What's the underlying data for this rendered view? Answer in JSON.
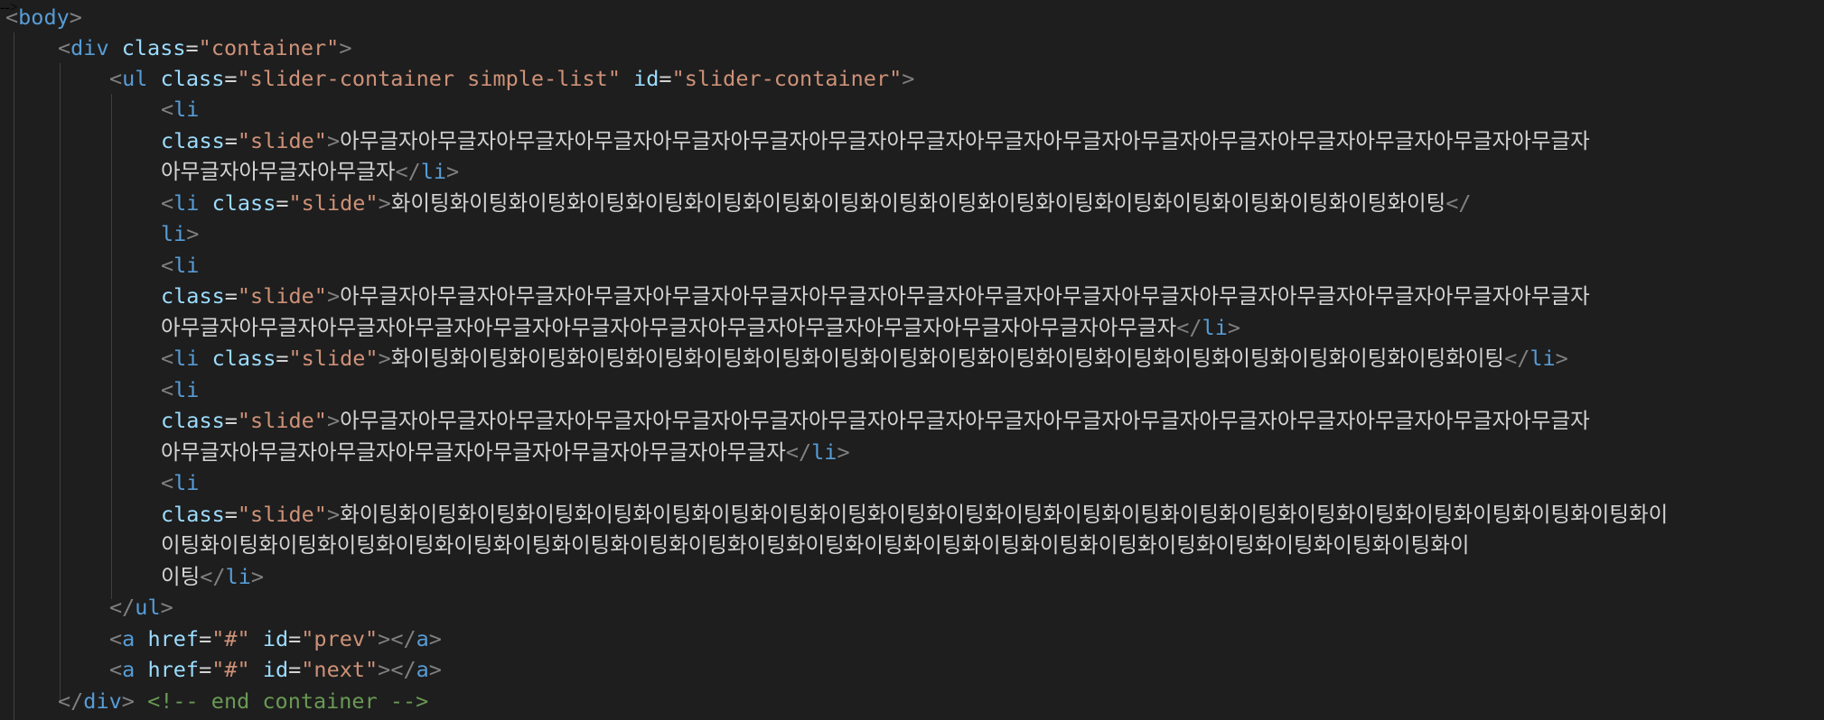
{
  "colors": {
    "background": "#1e1e1e",
    "tag": "#569cd6",
    "bracket": "#808080",
    "attribute": "#9cdcfe",
    "string": "#ce9178",
    "text": "#d4d4d4",
    "comment": "#6a9955",
    "indent_guide": "#404040"
  },
  "code": {
    "body_tag": "body",
    "div_tag": "div",
    "ul_tag": "ul",
    "li_tag": "li",
    "a_tag": "a",
    "class_attr": "class",
    "id_attr": "id",
    "href_attr": "href",
    "container_val": "\"container\"",
    "ul_class_val": "\"slider-container simple-list\"",
    "ul_id_val": "\"slider-container\"",
    "slide_val": "\"slide\"",
    "href_val": "\"#\"",
    "prev_val": "\"prev\"",
    "next_val": "\"next\"",
    "li_frag": "li",
    "comment": "<!-- end container -->",
    "text_amugeulja_row": "아무글자아무글자아무글자아무글자아무글자아무글자아무글자아무글자아무글자아무글자아무글자아무글자아무글자아무글자아무글자아무글자",
    "text_amugeulja_3": "아무글자아무글자아무글자",
    "text_hwaiting_li2": "화이팅화이팅화이팅화이팅화이팅화이팅화이팅화이팅화이팅화이팅화이팅화이팅화이팅화이팅화이팅화이팅화이팅화이팅",
    "text_amugeulja_13": "아무글자아무글자아무글자아무글자아무글자아무글자아무글자아무글자아무글자아무글자아무글자아무글자아무글자",
    "text_hwaiting_li4": "화이팅화이팅화이팅화이팅화이팅화이팅화이팅화이팅화이팅화이팅화이팅화이팅화이팅화이팅화이팅화이팅화이팅화이팅화이팅",
    "text_amugeulja_8": "아무글자아무글자아무글자아무글자아무글자아무글자아무글자아무글자",
    "text_hwaiting_row": "화이팅화이팅화이팅화이팅화이팅화이팅화이팅화이팅화이팅화이팅화이팅화이팅화이팅화이팅화이팅화이팅화이팅화이팅화이팅화이팅화이팅화이팅화이",
    "text_ihwaiting_row": "이팅화이팅화이팅화이팅화이팅화이팅화이팅화이팅화이팅화이팅화이팅화이팅화이팅화이팅화이팅화이팅화이팅화이팅화이팅화이팅화이팅화이팅화이",
    "text_iting": "이팅"
  }
}
